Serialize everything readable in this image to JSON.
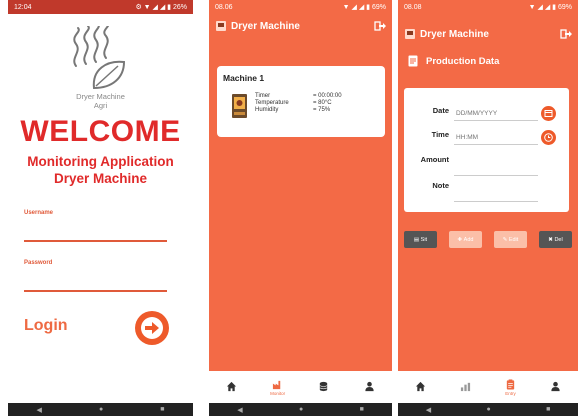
{
  "screen1": {
    "status": {
      "time": "12:04",
      "right": "⚙ ▼ ◢ ◢ ▮ 26%"
    },
    "brand": [
      "Dryer Machine",
      "Agri"
    ],
    "welcome": "WELCOME",
    "subtitle": [
      "Monitoring Application",
      "Dryer Machine"
    ],
    "username_label": "Username",
    "password_label": "Password",
    "login_label": "Login",
    "nav": [
      "◀",
      "●",
      "■"
    ]
  },
  "screen2": {
    "status": {
      "time": "08.06",
      "right": "▼ ◢ ◢ ▮ 69%"
    },
    "app_title": "Dryer Machine",
    "machine": {
      "name": "Machine 1",
      "labels": [
        "Timer",
        "Temperature",
        "Humidity"
      ],
      "values": [
        "= 00:00:00",
        "= 80°C",
        "= 75%"
      ]
    },
    "tabs": [
      {
        "name": "home",
        "label": ""
      },
      {
        "name": "monitor",
        "label": "Monitor"
      },
      {
        "name": "database",
        "label": ""
      },
      {
        "name": "profile",
        "label": ""
      }
    ],
    "nav": [
      "◀",
      "●",
      "■"
    ]
  },
  "screen3": {
    "status": {
      "time": "08.08",
      "right": "▼ ◢ ◢ ▮ 69%"
    },
    "app_title": "Dryer Machine",
    "section_title": "Production Data",
    "form": {
      "date_label": "Date",
      "date_placeholder": "DD/MM/YYYY",
      "time_label": "Time",
      "time_placeholder": "HH:MM",
      "amount_label": "Amount",
      "note_label": "Note"
    },
    "buttons": [
      "Sit",
      "Add",
      "Edit",
      "Del"
    ],
    "tabs": [
      {
        "name": "home",
        "label": ""
      },
      {
        "name": "chart",
        "label": ""
      },
      {
        "name": "entry",
        "label": "Entry"
      },
      {
        "name": "profile",
        "label": ""
      }
    ],
    "nav": [
      "◀",
      "●",
      "■"
    ]
  },
  "colors": {
    "accent": "#f36a46",
    "welcome_red": "#e02a2a",
    "button_orange": "#ee5a2a"
  }
}
